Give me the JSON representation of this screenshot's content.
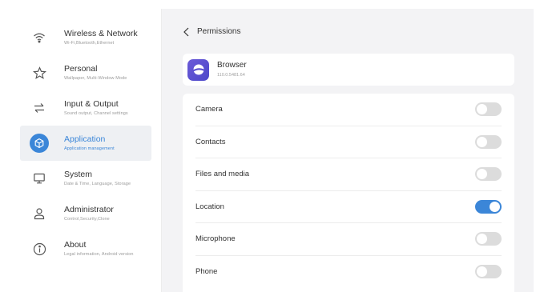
{
  "sidebar": {
    "items": [
      {
        "title": "Wireless & Network",
        "subtitle": "Wi-Fi,Bluetooth,Ethernet",
        "icon": "wifi-icon",
        "active": false
      },
      {
        "title": "Personal",
        "subtitle": "Wallpaper, Multi-Window Mode",
        "icon": "star-icon",
        "active": false
      },
      {
        "title": "Input & Output",
        "subtitle": "Sound output, Channel settings",
        "icon": "swap-arrows-icon",
        "active": false
      },
      {
        "title": "Application",
        "subtitle": "Application management",
        "icon": "cube-icon",
        "active": true
      },
      {
        "title": "System",
        "subtitle": "Date & Time, Language, Storage",
        "icon": "monitor-icon",
        "active": false
      },
      {
        "title": "Administrator",
        "subtitle": "Control,Security,Clone",
        "icon": "person-icon",
        "active": false
      },
      {
        "title": "About",
        "subtitle": "Legal information, Android version",
        "icon": "info-icon",
        "active": false
      }
    ]
  },
  "header": {
    "title": "Permissions"
  },
  "app": {
    "name": "Browser",
    "version": "110.0.5481.64",
    "icon": "browser-app-icon",
    "icon_color": "#5a4fd0"
  },
  "permissions": [
    {
      "label": "Camera",
      "enabled": false
    },
    {
      "label": "Contacts",
      "enabled": false
    },
    {
      "label": "Files and media",
      "enabled": false
    },
    {
      "label": "Location",
      "enabled": true
    },
    {
      "label": "Microphone",
      "enabled": false
    },
    {
      "label": "Phone",
      "enabled": false
    }
  ],
  "colors": {
    "accent": "#3b86d8",
    "background": "#f3f3f5",
    "toggle_off": "#dcdcdc"
  }
}
